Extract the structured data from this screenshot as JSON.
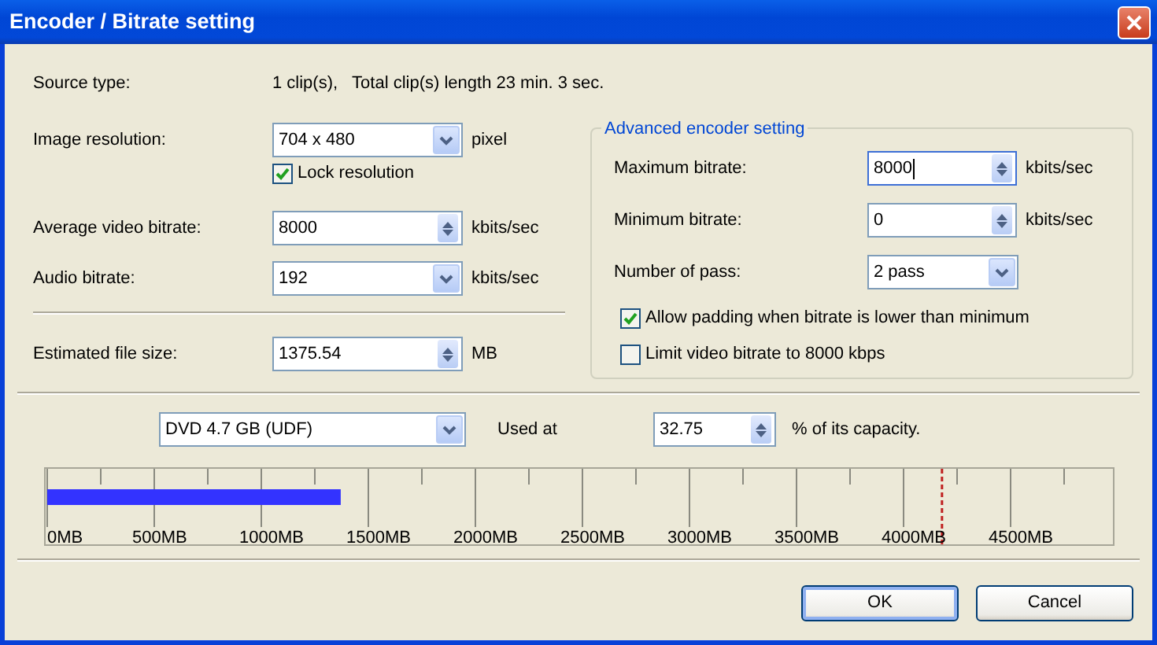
{
  "window": {
    "title": "Encoder / Bitrate setting"
  },
  "source": {
    "label": "Source type:",
    "value": "1 clip(s),   Total clip(s) length 23 min. 3 sec."
  },
  "left_fields": [
    {
      "kind": "combo",
      "label": "Image resolution:",
      "value": "704 x 480",
      "unit": "pixel"
    },
    {
      "kind": "checkbox",
      "label": "Lock resolution",
      "checked": true
    },
    {
      "kind": "spin",
      "label": "Average video bitrate:",
      "value": "8000",
      "unit": "kbits/sec"
    },
    {
      "kind": "combo",
      "label": "Audio bitrate:",
      "value": "192",
      "unit": "kbits/sec"
    }
  ],
  "estimated": {
    "kind": "spin",
    "label": "Estimated file size:",
    "value": "1375.54",
    "unit": "MB"
  },
  "advanced": {
    "title": "Advanced encoder setting",
    "fields": [
      {
        "kind": "spin",
        "label": "Maximum bitrate:",
        "value": "8000",
        "unit": "kbits/sec",
        "focused": true
      },
      {
        "kind": "spin",
        "label": "Minimum bitrate:",
        "value": "0",
        "unit": "kbits/sec",
        "focused": false
      },
      {
        "kind": "combo",
        "label": "Number of pass:",
        "value": "2 pass"
      },
      {
        "kind": "checkbox",
        "label": "Allow padding when bitrate is lower than minimum",
        "checked": true
      },
      {
        "kind": "checkbox",
        "label": "Limit video bitrate to 8000 kbps",
        "checked": false
      }
    ]
  },
  "disc": {
    "media": "DVD 4.7 GB (UDF)",
    "used_label": "Used at",
    "percent": "32.75",
    "percent_suffix": "% of its capacity."
  },
  "meter": {
    "level": 0.275,
    "capacity_mark": {
      "level": 0.838
    },
    "tick_labels": [
      "0MB",
      "500MB",
      "1000MB",
      "1500MB",
      "2000MB",
      "2500MB",
      "3000MB",
      "3500MB",
      "4000MB",
      "4500MB"
    ]
  },
  "buttons": [
    {
      "label": "OK",
      "default": true
    },
    {
      "label": "Cancel",
      "default": false
    }
  ]
}
